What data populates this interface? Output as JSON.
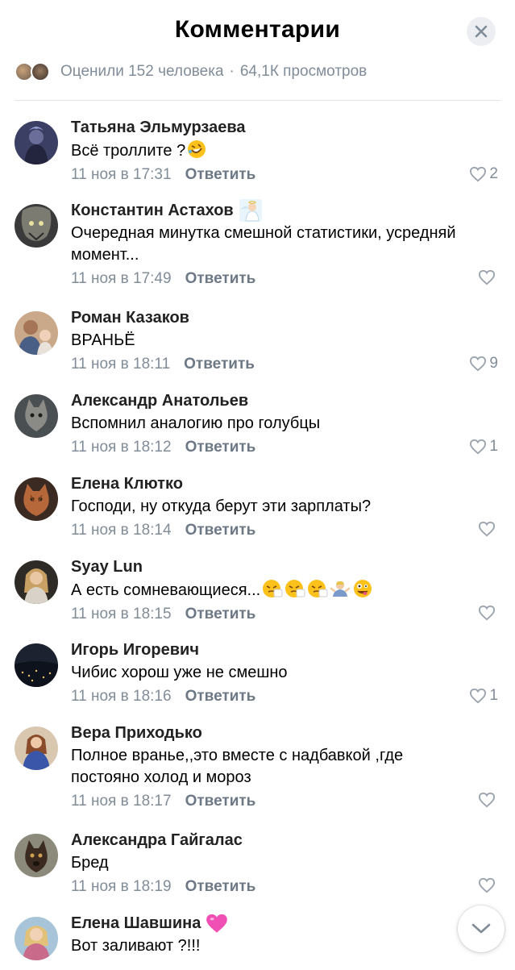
{
  "header": {
    "title": "Комментарии",
    "close_icon": "close-icon"
  },
  "meta": {
    "likes_text": "Оценили 152 человека",
    "separator": "·",
    "views_text": "64,1К просмотров"
  },
  "actions": {
    "reply_label": "Ответить"
  },
  "colors": {
    "secondary_text": "#818c99",
    "reply_text": "#6d7885",
    "divider": "#e4e6ea",
    "close_bg": "#eceef1"
  },
  "comments": [
    {
      "author": "Татьяна Эльмурзаева",
      "text": "Всё троллите ?",
      "text_emoji": "rofl-emoji",
      "date": "11 ноя в 17:31",
      "likes": "2"
    },
    {
      "author": "Константин Астахов",
      "author_badge": "angel-sticker-icon",
      "text": "Очередная минутка смешной статистики, усредняй",
      "text2": "момент...",
      "date": "11 ноя в 17:49",
      "likes": ""
    },
    {
      "author": "Роман Казаков",
      "text": "ВРАНЬЁ",
      "date": "11 ноя в 18:11",
      "likes": "9"
    },
    {
      "author": "Александр Анатольев",
      "text": "Вспомнил аналогию про голубцы",
      "date": "11 ноя в 18:12",
      "likes": "1"
    },
    {
      "author": "Елена Клютко",
      "text": "Господи, ну откуда берут эти зарплаты?",
      "date": "11 ноя в 18:14",
      "likes": ""
    },
    {
      "author": "Syay Lun",
      "text": "А есть сомневающиеся...",
      "text_emoji": "sneezing-emoji ×3, shrug-emoji, zany-emoji",
      "date": "11 ноя в 18:15",
      "likes": ""
    },
    {
      "author": "Игорь Игоревич",
      "text": "Чибис хорош уже не смешно",
      "date": "11 ноя в 18:16",
      "likes": "1"
    },
    {
      "author": "Вера Приходько",
      "text": "Полное вранье,,это вместе с надбавкой ,где",
      "text2": "постояно холод и мороз",
      "date": "11 ноя в 18:17",
      "likes": ""
    },
    {
      "author": "Александра Гайгалас",
      "text": "Бред",
      "date": "11 ноя в 18:19",
      "likes": ""
    },
    {
      "author": "Елена Шавшина",
      "author_badge": "pink-heart-emoji",
      "text": "Вот заливают ?!!!",
      "date": "",
      "likes": ""
    }
  ],
  "scroll_down_icon": "chevron-down-icon"
}
